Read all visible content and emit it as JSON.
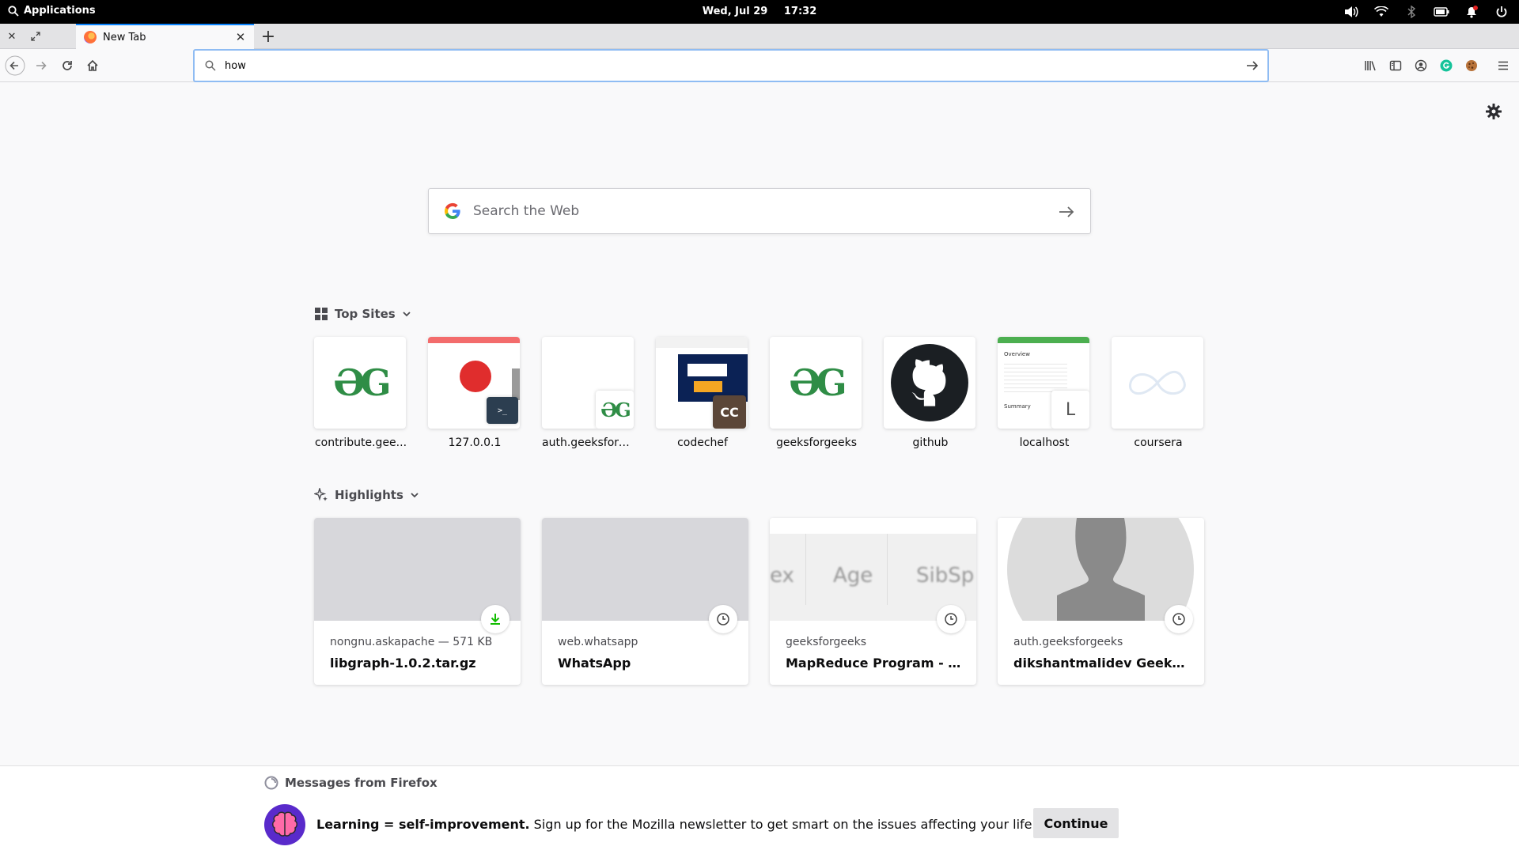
{
  "panel": {
    "applications": "Applications",
    "date": "Wed, Jul 29",
    "time": "17:32"
  },
  "tabs": [
    {
      "title": "New Tab"
    }
  ],
  "urlbar": {
    "value": "how"
  },
  "search": {
    "placeholder": "Search the Web"
  },
  "top_sites": {
    "heading": "Top Sites",
    "sites": [
      {
        "label": "contribute.gee...",
        "icon": "gfg-logo"
      },
      {
        "label": "127.0.0.1",
        "icon": "screenshot"
      },
      {
        "label": "auth.geeksforg...",
        "icon": "gfg-logo"
      },
      {
        "label": "codechef",
        "icon": "codechef"
      },
      {
        "label": "geeksforgeeks",
        "icon": "gfg-logo"
      },
      {
        "label": "github",
        "icon": "github-logo"
      },
      {
        "label": "localhost",
        "icon": "screenshot",
        "letter": "L",
        "lines": [
          "Overview",
          "Summary"
        ]
      },
      {
        "label": "coursera",
        "icon": "coursera-logo"
      }
    ]
  },
  "highlights": {
    "heading": "Highlights",
    "cards": [
      {
        "source": "nongnu.askapache — 571 KB",
        "title": "libgraph-1.0.2.tar.gz",
        "badge": "download-icon"
      },
      {
        "source": "web.whatsapp",
        "title": "WhatsApp",
        "badge": "history-icon"
      },
      {
        "source": "geeksforgeeks",
        "title": "MapReduce Program - Fin...",
        "badge": "history-icon",
        "thumb_text": [
          "ex",
          "Age",
          "SibSp"
        ]
      },
      {
        "source": "auth.geeksforgeeks",
        "title": "dikshantmalidev Geeksfo...",
        "badge": "history-icon"
      }
    ]
  },
  "messages": {
    "heading": "Messages from Firefox",
    "bold": "Learning = self-improvement.",
    "text": " Sign up for the Mozilla newsletter to get smart on the issues affecting your life online.",
    "button": "Continue"
  },
  "colors": {
    "accent": "#0a84ff",
    "gfg_green": "#2f8d46",
    "download_green": "#12bc00"
  }
}
